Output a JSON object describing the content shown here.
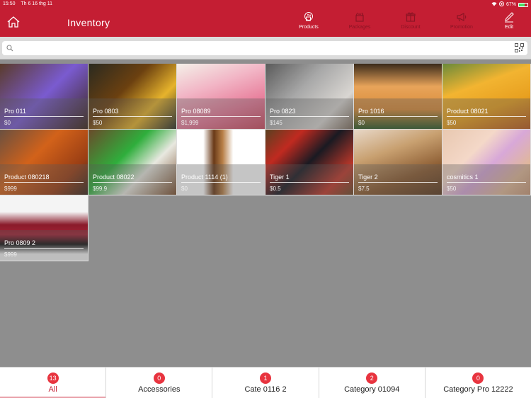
{
  "status_bar": {
    "time": "15:50",
    "date": "Th 6 16 thg 11",
    "battery_percent": "67%",
    "battery_level": 0.67
  },
  "header": {
    "title": "Inventory",
    "home_icon": "home-icon",
    "nav": [
      {
        "label": "Products",
        "icon": "products-icon",
        "active": true
      },
      {
        "label": "Packages",
        "icon": "packages-icon",
        "active": false
      },
      {
        "label": "Discount",
        "icon": "gift-icon",
        "active": false
      },
      {
        "label": "Promotion",
        "icon": "megaphone-icon",
        "active": false
      },
      {
        "label": "Edit",
        "icon": "pencil-icon",
        "active": false
      }
    ]
  },
  "search": {
    "value": "",
    "placeholder": "",
    "icon": "search-icon",
    "scan_icon": "qr-code-icon"
  },
  "colors": {
    "brand": "#c41e33",
    "badge": "#e8343f",
    "content_bg": "#8e8e8e"
  },
  "products": [
    {
      "name": "Pro 011",
      "price": "$0",
      "bg": "linear-gradient(135deg,#5a3b2a 0%,#7a5bd0 50%,#3b2618 100%)"
    },
    {
      "name": "Pro 0803",
      "price": "$50",
      "bg": "linear-gradient(135deg,#2a2a20 0%,#6b4010 40%,#e6b32c 70%,#2a2f2a 100%)"
    },
    {
      "name": "Pro 08089",
      "price": "$1,999",
      "bg": "linear-gradient(160deg,#f4f0e8 0%,#f2b6c6 35%,#e77a98 70%,#c94c60 100%)"
    },
    {
      "name": "Pro 0823",
      "price": "$145",
      "bg": "linear-gradient(135deg,#5a5a5a 0%,#a8a8a8 40%,#d9d6d2 75%,#7a6a5a 100%)"
    },
    {
      "name": "Pro 1016",
      "price": "$0",
      "bg": "linear-gradient(180deg,#3a2a1a 0%,#e8a45a 35%,#d98d3c 70%,#2f5a2a 100%)"
    },
    {
      "name": "Product 08021",
      "price": "$50",
      "bg": "linear-gradient(160deg,#6a8a3a 0%,#f2b431 35%,#e8a020 65%,#b85a20 100%)"
    },
    {
      "name": "Product 080218",
      "price": "$999",
      "bg": "linear-gradient(135deg,#6a5040 0%,#d2621a 40%,#9a3e14 75%,#3a2a22 100%)"
    },
    {
      "name": "Product 08022",
      "price": "$99.9",
      "bg": "linear-gradient(135deg,#6a4a2a 0%,#2fae3c 40%,#e8e8e0 65%,#7a5030 100%)"
    },
    {
      "name": "Product 1114 (1)",
      "price": "$0",
      "bg": "linear-gradient(90deg,#ffffff 0%,#ffffff 30%,#6a3a18 42%,#b88048 52%,#ffffff 64%,#ffffff 100%)"
    },
    {
      "name": "Tiger 1",
      "price": "$0.5",
      "bg": "linear-gradient(135deg,#5a4020 0%,#c02a20 25%,#1a1a22 50%,#c0382a 80%,#6a4a2a 100%)"
    },
    {
      "name": "Tiger 2",
      "price": "$7.5",
      "bg": "linear-gradient(160deg,#e8d8c8 0%,#c8a070 35%,#8a5a30 70%,#5a3a20 100%)"
    },
    {
      "name": "cosmitics 1",
      "price": "$50",
      "bg": "linear-gradient(135deg,#e8c8b0 0%,#f4d8c8 35%,#d8a8d8 55%,#e0b898 80%,#c89878 100%)"
    },
    {
      "name": "Pro 0809 2",
      "price": "$999",
      "bg": "linear-gradient(180deg,#f4f4f4 0%,#f4f4f4 25%,#8a1a2a 45%,#a02436 60%,#151515 75%,#f4f4f4 90%)"
    }
  ],
  "category_tabs": [
    {
      "label": "All",
      "count": "13",
      "active": true
    },
    {
      "label": "Accessories",
      "count": "0",
      "active": false
    },
    {
      "label": "Cate 0116 2",
      "count": "1",
      "active": false
    },
    {
      "label": "Category 01094",
      "count": "2",
      "active": false
    },
    {
      "label": "Category Pro 12222",
      "count": "0",
      "active": false
    }
  ]
}
